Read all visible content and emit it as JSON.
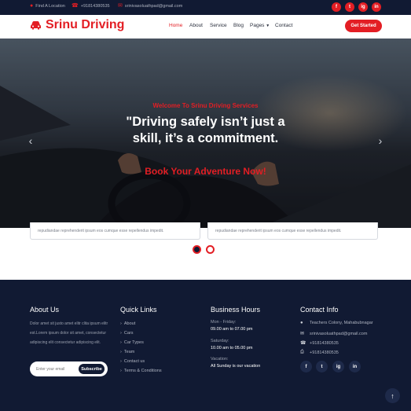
{
  "topbar": {
    "location": "Find A Location",
    "phone": "+91814380535",
    "email": "srinivasoluathpad@gmail.com",
    "social": [
      "f",
      "t",
      "ig",
      "in"
    ]
  },
  "nav": {
    "brand": "Srinu Driving",
    "links": [
      "Home",
      "About",
      "Service",
      "Blog",
      "Pages",
      "Contact"
    ],
    "cta": "Get Started"
  },
  "hero": {
    "subtitle": "Welcome To Srinu Driving Services",
    "title": "\"Driving safely isn’t just a skill, it’s a commitment.",
    "cta": "Book Your Adventure Now!"
  },
  "cards": [
    {
      "text": "repudiandae reprehenderit ipsum eos cumque esse repellendus impedit."
    },
    {
      "text": "repudiandae reprehenderit ipsum eos cumque esse repellendus impedit."
    }
  ],
  "footer": {
    "about": {
      "title": "About Us",
      "text": "Dolor amet sit justo amet elitr clita ipsum elitr est.Lorem ipsum dolor sit amet, consectetur adipiscing elit consectetur adipiscing elit.",
      "email_placeholder": "Enter your email",
      "subscribe": "Subscribe"
    },
    "links": {
      "title": "Quick Links",
      "items": [
        "About",
        "Cars",
        "Car Types",
        "Team",
        "Contact us",
        "Terms & Conditions"
      ]
    },
    "hours": {
      "title": "Business Hours",
      "rows": [
        {
          "label": "Mon - Friday:",
          "value": "09.00 am to 07.00 pm"
        },
        {
          "label": "Saturday:",
          "value": "10.00 am to 05.00 pm"
        },
        {
          "label": "Vacation:",
          "value": "All Sunday is our vacation"
        }
      ]
    },
    "contact": {
      "title": "Contact Info",
      "address": "Teachers Colony, Mahabubnagar",
      "email": "srinivasoluathpad@gmail.com",
      "phone": "+91814380535",
      "fax": "+91814380535",
      "social": [
        "f",
        "t",
        "ig",
        "in"
      ]
    }
  }
}
